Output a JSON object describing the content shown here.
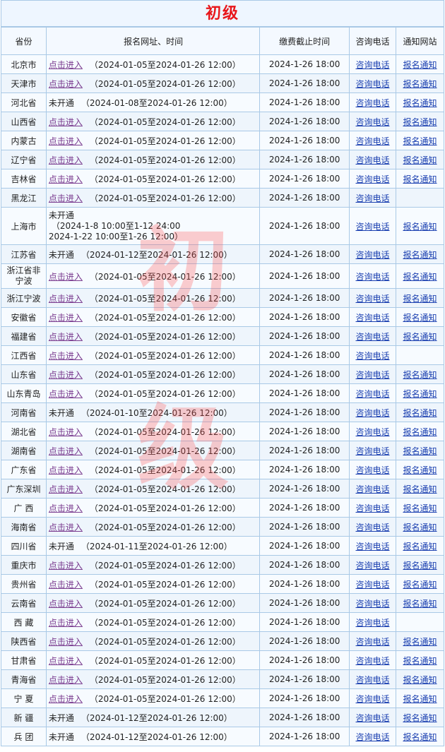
{
  "title": "初级",
  "watermark": [
    "初",
    "级"
  ],
  "headers": {
    "province": "省份",
    "time": "报名网址、时间",
    "payment": "缴费截止时间",
    "phone": "咨询电话",
    "notice": "通知网站"
  },
  "labels": {
    "enter": "点击进入",
    "not_open": "未开通",
    "phone": "咨询电话",
    "notice": "报名通知"
  },
  "rows": [
    {
      "province": "北京市",
      "status": "点击进入",
      "period": "（2024-01-05至2024-01-26 12:00）",
      "payment": "2024-1-26 18:00",
      "phone": "咨询电话",
      "notice": "报名通知"
    },
    {
      "province": "天津市",
      "status": "点击进入",
      "period": "（2024-01-05至2024-01-26 12:00）",
      "payment": "2024-1-26 18:00",
      "phone": "咨询电话",
      "notice": "报名通知"
    },
    {
      "province": "河北省",
      "status": "未开通",
      "period": "（2024-01-08至2024-01-26 12:00）",
      "payment": "2024-1-26 18:00",
      "phone": "咨询电话",
      "notice": "报名通知"
    },
    {
      "province": "山西省",
      "status": "点击进入",
      "period": "（2024-01-05至2024-01-26 12:00）",
      "payment": "2024-1-26 18:00",
      "phone": "咨询电话",
      "notice": "报名通知"
    },
    {
      "province": "内蒙古",
      "status": "点击进入",
      "period": "（2024-01-05至2024-01-26 12:00）",
      "payment": "2024-1-26 18:00",
      "phone": "咨询电话",
      "notice": "报名通知"
    },
    {
      "province": "辽宁省",
      "status": "点击进入",
      "period": "（2024-01-05至2024-01-26 12:00）",
      "payment": "2024-1-26 18:00",
      "phone": "咨询电话",
      "notice": "报名通知"
    },
    {
      "province": "吉林省",
      "status": "点击进入",
      "period": "（2024-01-05至2024-01-26 12:00）",
      "payment": "2024-1-26 18:00",
      "phone": "咨询电话",
      "notice": "报名通知"
    },
    {
      "province": "黑龙江",
      "status": "点击进入",
      "period": "（2024-01-05至2024-01-26 12:00）",
      "payment": "2024-1-26 18:00",
      "phone": "咨询电话",
      "notice": ""
    },
    {
      "province": "上海市",
      "status": "未开通",
      "period_lines": [
        "（2024-1-8 10:00至1-12 24:00",
        "2024-1-22 10:00至1-26 12:00）"
      ],
      "payment": "2024-1-26 18:00",
      "phone": "咨询电话",
      "notice": "报名通知"
    },
    {
      "province": "江苏省",
      "status": "未开通",
      "period": "（2024-01-12至2024-01-26 12:00）",
      "payment": "2024-1-26 18:00",
      "phone": "咨询电话",
      "notice": "报名通知"
    },
    {
      "province": "浙江省非宁波",
      "status": "点击进入",
      "period": "（2024-01-05至2024-01-26 12:00）",
      "payment": "2024-1-26 18:00",
      "phone": "咨询电话",
      "notice": "报名通知"
    },
    {
      "province": "浙江宁波",
      "status": "点击进入",
      "period": "（2024-01-05至2024-01-26 12:00）",
      "payment": "2024-1-26 18:00",
      "phone": "咨询电话",
      "notice": "报名通知"
    },
    {
      "province": "安徽省",
      "status": "点击进入",
      "period": "（2024-01-05至2024-01-26 12:00）",
      "payment": "2024-1-26 18:00",
      "phone": "咨询电话",
      "notice": "报名通知"
    },
    {
      "province": "福建省",
      "status": "点击进入",
      "period": "（2024-01-05至2024-01-26 12:00）",
      "payment": "2024-1-26 18:00",
      "phone": "咨询电话",
      "notice": "报名通知"
    },
    {
      "province": "江西省",
      "status": "点击进入",
      "period": "（2024-01-05至2024-01-26 12:00）",
      "payment": "2024-1-26 18:00",
      "phone": "咨询电话",
      "notice": ""
    },
    {
      "province": "山东省",
      "status": "点击进入",
      "period": "（2024-01-05至2024-01-26 12:00）",
      "payment": "2024-1-26 18:00",
      "phone": "咨询电话",
      "notice": "报名通知"
    },
    {
      "province": "山东青岛",
      "status": "点击进入",
      "period": "（2024-01-05至2024-01-26 12:00）",
      "payment": "2024-1-26 18:00",
      "phone": "咨询电话",
      "notice": "报名通知"
    },
    {
      "province": "河南省",
      "status": "未开通",
      "period": "（2024-01-10至2024-01-26 12:00）",
      "payment": "2024-1-26 18:00",
      "phone": "咨询电话",
      "notice": "报名通知"
    },
    {
      "province": "湖北省",
      "status": "点击进入",
      "period": "（2024-01-05至2024-01-26 12:00）",
      "payment": "2024-1-26 18:00",
      "phone": "咨询电话",
      "notice": "报名通知"
    },
    {
      "province": "湖南省",
      "status": "点击进入",
      "period": "（2024-01-05至2024-01-26 12:00）",
      "payment": "2024-1-26 18:00",
      "phone": "咨询电话",
      "notice": "报名通知"
    },
    {
      "province": "广东省",
      "status": "点击进入",
      "period": "（2024-01-05至2024-01-26 12:00）",
      "payment": "2024-1-26 18:00",
      "phone": "咨询电话",
      "notice": "报名通知"
    },
    {
      "province": "广东深圳",
      "status": "点击进入",
      "period": "（2024-01-05至2024-01-26 12:00）",
      "payment": "2024-1-26 18:00",
      "phone": "咨询电话",
      "notice": "报名通知"
    },
    {
      "province": "广 西",
      "status": "点击进入",
      "period": "（2024-01-05至2024-01-26 12:00）",
      "payment": "2024-1-26 18:00",
      "phone": "咨询电话",
      "notice": "报名通知"
    },
    {
      "province": "海南省",
      "status": "点击进入",
      "period": "（2024-01-05至2024-01-26 12:00）",
      "payment": "2024-1-26 18:00",
      "phone": "咨询电话",
      "notice": "报名通知"
    },
    {
      "province": "四川省",
      "status": "未开通",
      "period": "（2024-01-11至2024-01-26 12:00）",
      "payment": "2024-1-26 18:00",
      "phone": "咨询电话",
      "notice": "报名通知"
    },
    {
      "province": "重庆市",
      "status": "点击进入",
      "period": "（2024-01-05至2024-01-26 12:00）",
      "payment": "2024-1-26 18:00",
      "phone": "咨询电话",
      "notice": "报名通知"
    },
    {
      "province": "贵州省",
      "status": "点击进入",
      "period": "（2024-01-05至2024-01-26 12:00）",
      "payment": "2024-1-26 18:00",
      "phone": "咨询电话",
      "notice": "报名通知"
    },
    {
      "province": "云南省",
      "status": "点击进入",
      "period": "（2024-01-05至2024-01-26 12:00）",
      "payment": "2024-1-26 18:00",
      "phone": "咨询电话",
      "notice": "报名通知"
    },
    {
      "province": "西 藏",
      "status": "点击进入",
      "period": "（2024-01-05至2024-01-26 12:00）",
      "payment": "2024-1-26 18:00",
      "phone": "咨询电话",
      "notice": ""
    },
    {
      "province": "陕西省",
      "status": "点击进入",
      "period": "（2024-01-05至2024-01-26 12:00）",
      "payment": "2024-1-26 18:00",
      "phone": "咨询电话",
      "notice": "报名通知"
    },
    {
      "province": "甘肃省",
      "status": "点击进入",
      "period": "（2024-01-05至2024-01-26 12:00）",
      "payment": "2024-1-26 18:00",
      "phone": "咨询电话",
      "notice": "报名通知"
    },
    {
      "province": "青海省",
      "status": "点击进入",
      "period": "（2024-01-05至2024-01-26 12:00）",
      "payment": "2024-1-26 18:00",
      "phone": "咨询电话",
      "notice": "报名通知"
    },
    {
      "province": "宁 夏",
      "status": "点击进入",
      "period": "（2024-01-05至2024-01-26 12:00）",
      "payment": "2024-1-26 18:00",
      "phone": "咨询电话",
      "notice": "报名通知"
    },
    {
      "province": "新 疆",
      "status": "未开通",
      "period": "（2024-01-12至2024-01-26 12:00）",
      "payment": "2024-1-26 18:00",
      "phone": "咨询电话",
      "notice": "报名通知"
    },
    {
      "province": "兵 团",
      "status": "未开通",
      "period": "（2024-01-12至2024-01-26 12:00）",
      "payment": "2024-1-26 18:00",
      "phone": "咨询电话",
      "notice": "报名通知"
    }
  ],
  "colors": {
    "title": "#e8161a",
    "border": "#a9c9e6",
    "link_enter": "#7a3b8f",
    "link": "#1a3fb0",
    "watermark": "#ff5050"
  }
}
